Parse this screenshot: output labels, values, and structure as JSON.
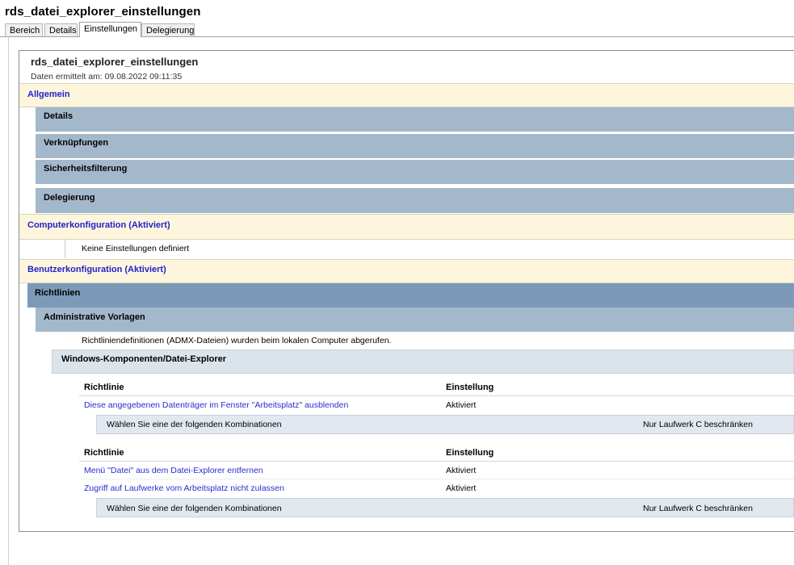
{
  "window": {
    "title": "rds_datei_explorer_einstellungen",
    "tabs": [
      "Bereich",
      "Details",
      "Einstellungen",
      "Delegierung"
    ],
    "active_tab": "Einstellungen"
  },
  "report": {
    "title": "rds_datei_explorer_einstellungen",
    "subtitle": "Daten ermittelt am: 09.08.2022 09:11:35"
  },
  "general": {
    "heading": "Allgemein",
    "items": [
      "Details",
      "Verknüpfungen",
      "Sicherheitsfilterung",
      "Delegierung"
    ]
  },
  "computer": {
    "heading": "Computerkonfiguration (Aktiviert)",
    "note": "Keine Einstellungen definiert"
  },
  "user": {
    "heading": "Benutzerkonfiguration (Aktiviert)",
    "policies_bar": "Richtlinien",
    "admin_templates_bar": "Administrative Vorlagen",
    "admx_note": "Richtliniendefinitionen (ADMX-Dateien) wurden beim lokalen Computer abgerufen.",
    "component_bar": "Windows-Komponenten/Datei-Explorer",
    "table1": {
      "col_policy": "Richtlinie",
      "col_setting": "Einstellung",
      "rows": [
        {
          "policy": "Diese angegebenen Datenträger im Fenster \"Arbeitsplatz\" ausblenden",
          "setting": "Aktiviert"
        }
      ],
      "combo": {
        "label": "Wählen Sie eine der folgenden Kombinationen",
        "value": "Nur Laufwerk C beschränken"
      }
    },
    "table2": {
      "col_policy": "Richtlinie",
      "col_setting": "Einstellung",
      "rows": [
        {
          "policy": "Menü \"Datei\" aus dem Datei-Explorer entfernen",
          "setting": "Aktiviert"
        },
        {
          "policy": "Zugriff auf Laufwerke vom Arbeitsplatz nicht zulassen",
          "setting": "Aktiviert"
        }
      ],
      "combo": {
        "label": "Wählen Sie eine der folgenden Kombinationen",
        "value": "Nur Laufwerk C beschränken"
      }
    }
  },
  "colors": {
    "section_yellow": "#fdf6dd",
    "section_link": "#2222cc",
    "bar_blue": "#a4b8cc",
    "bar_dark": "#7c9ab7",
    "bar_light": "#dce4eb",
    "policy_link": "#2b2bd0"
  }
}
